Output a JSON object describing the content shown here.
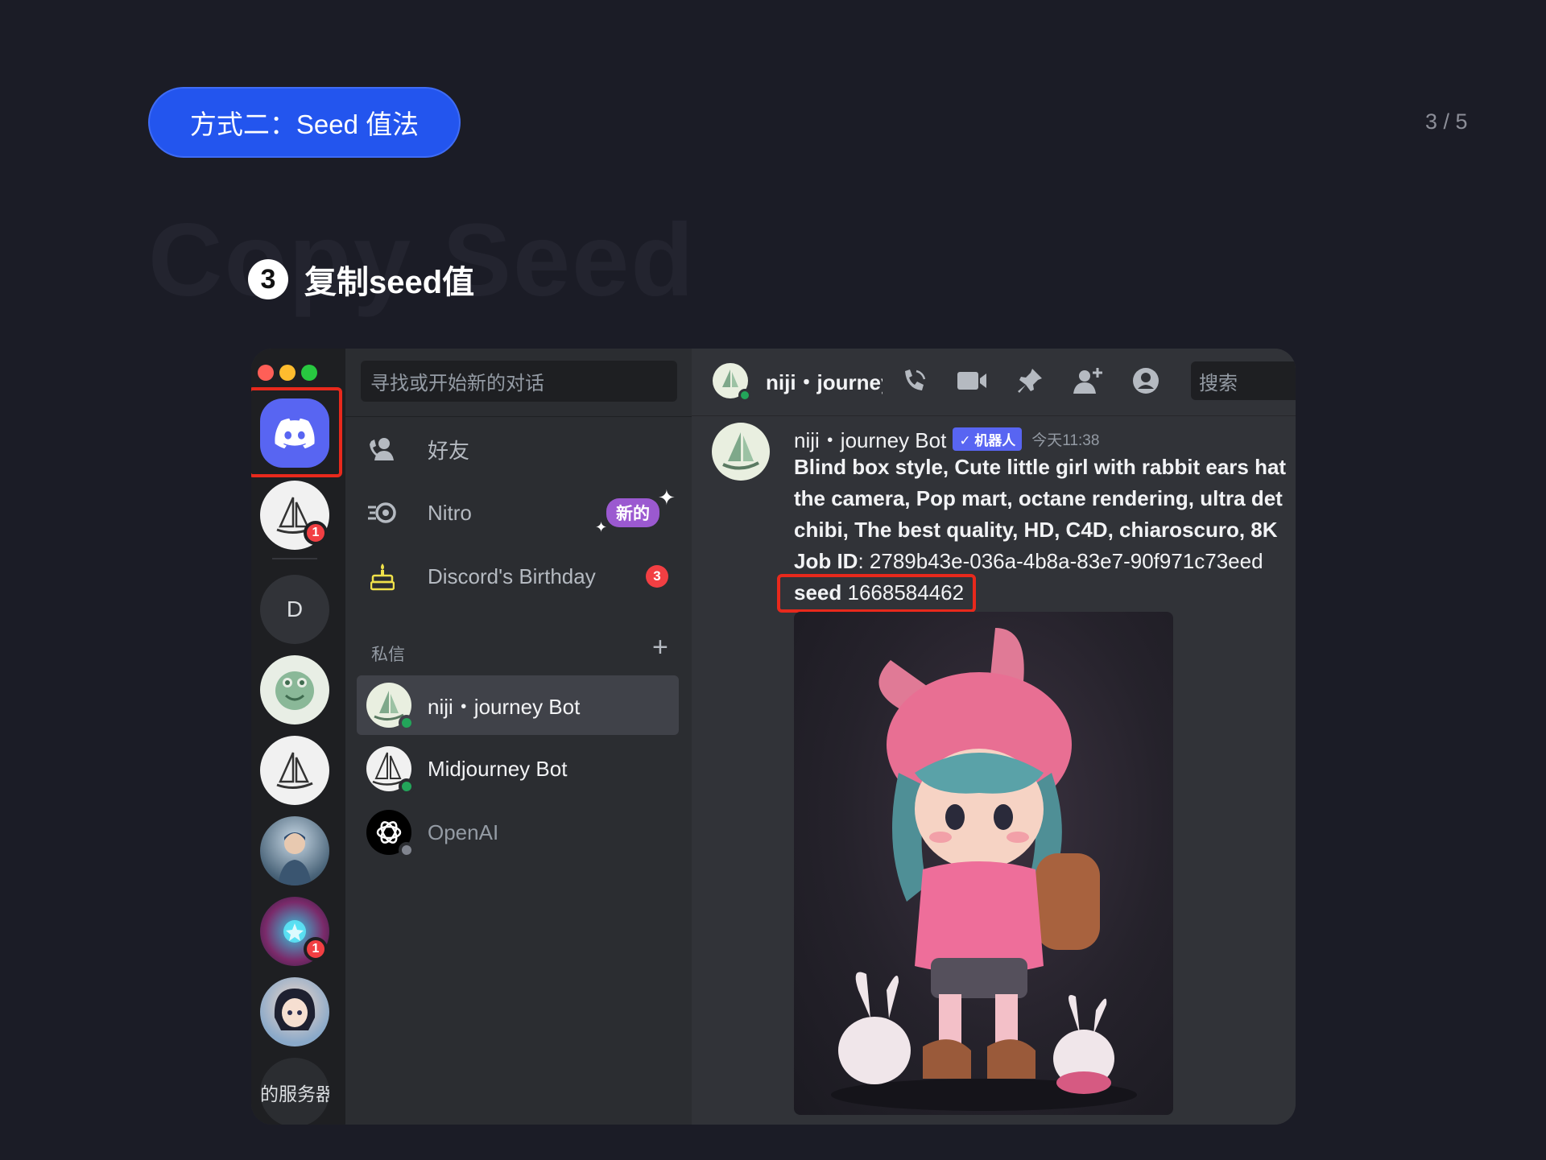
{
  "slide": {
    "method_pill": "方式二：Seed 值法",
    "page_indicator": "3 / 5",
    "background_title": "Copy Seed",
    "step_number": "3",
    "step_label": "复制seed值"
  },
  "discord": {
    "servers": [
      {
        "name": "discord-home-icon"
      },
      {
        "name": "midjourney-server",
        "badge": "1"
      },
      {
        "name": "d-server",
        "letter": "D"
      },
      {
        "name": "frog-server"
      },
      {
        "name": "sailboat-server"
      },
      {
        "name": "warrior-server"
      },
      {
        "name": "robot-art-server",
        "badge": "1"
      },
      {
        "name": "anime-girl-server"
      },
      {
        "name": "more-servers",
        "label": "的服务器"
      }
    ],
    "dm_search_placeholder": "寻找或开始新的对话",
    "nav": [
      {
        "label": "好友"
      },
      {
        "label": "Nitro",
        "badge": "新的"
      },
      {
        "label": "Discord's Birthday",
        "count": "3"
      }
    ],
    "dm_header": "私信",
    "dm_add": "+",
    "dms": [
      {
        "name": "niji・journey Bot",
        "active": true,
        "status": "online"
      },
      {
        "name": "Midjourney Bot",
        "active": false,
        "status": "online"
      },
      {
        "name": "OpenAI",
        "active": false,
        "status": "offline"
      }
    ],
    "chat": {
      "channel_name": "niji・journey",
      "search_placeholder": "搜索",
      "author": "niji・journey Bot",
      "bot_tag": "✓ 机器人",
      "timestamp": "今天11:38",
      "prompt_lines": [
        "Blind box style, Cute little girl with rabbit ears hat",
        "the camera, Pop mart, octane rendering, ultra det",
        "chibi, The best quality, HD, C4D, chiaroscuro, 8K"
      ],
      "job_id_label": "Job ID",
      "job_id_value": ": 2789b43e-036a-4b8a-83e7-90f971c73eed",
      "seed_label": "seed",
      "seed_value": " 1668584462"
    }
  },
  "colors": {
    "accent": "#2355ee",
    "highlight": "#e8291c",
    "discord_blurple": "#5865f2",
    "online": "#23a55a"
  }
}
